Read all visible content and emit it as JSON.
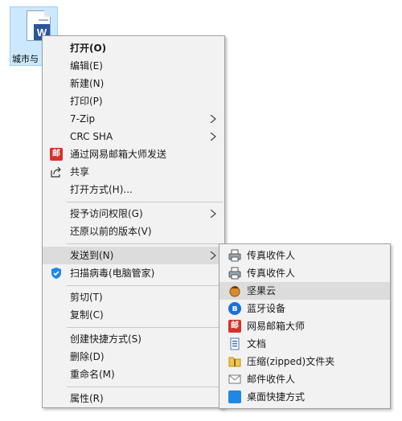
{
  "desktop": {
    "file_label": "城市与",
    "badge": "W"
  },
  "context_menu": {
    "items": {
      "open": "打开(O)",
      "edit": "编辑(E)",
      "new": "新建(N)",
      "print": "打印(P)",
      "zip": "7-Zip",
      "crc": "CRC SHA",
      "netease_send": "通过网易邮箱大师发送",
      "share": "共享",
      "open_with": "打开方式(H)...",
      "grant_access": "授予访问权限(G)",
      "restore": "还原以前的版本(V)",
      "send_to": "发送到(N)",
      "scan": "扫描病毒(电脑管家)",
      "cut": "剪切(T)",
      "copy": "复制(C)",
      "shortcut": "创建快捷方式(S)",
      "delete": "删除(D)",
      "rename": "重命名(M)",
      "properties": "属性(R)"
    }
  },
  "send_to_menu": {
    "items": {
      "fax1": "传真收件人",
      "fax2": "传真收件人",
      "jianguoyun": "坚果云",
      "bluetooth": "蓝牙设备",
      "netease": "网易邮箱大师",
      "documents": "文档",
      "zip": "压缩(zipped)文件夹",
      "mail": "邮件收件人",
      "desktop": "桌面快捷方式"
    }
  },
  "icons": {
    "netease_glyph": "邮",
    "bluetooth_glyph": "ʙ"
  },
  "colors": {
    "menu_bg": "#f2f2f2",
    "highlight": "#dcdcdc",
    "selection_bg": "#cce8ff",
    "netease_red": "#d6312b",
    "word_blue": "#2b579a"
  }
}
